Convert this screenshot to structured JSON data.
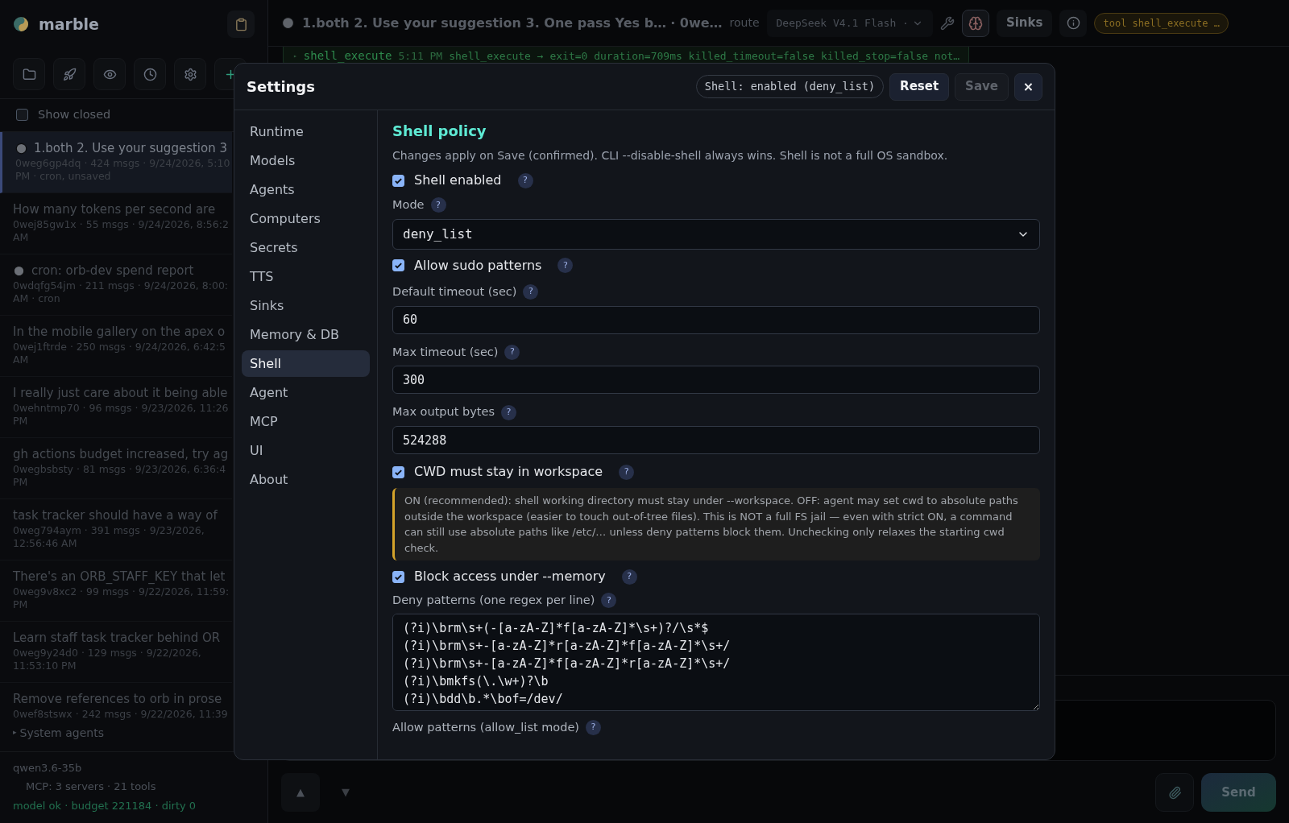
{
  "sidebar": {
    "app_name": "marble",
    "show_closed": {
      "label": "Show closed",
      "checked": false
    },
    "sessions": [
      {
        "title": "1.both 2. Use your suggestion 3",
        "meta": [
          "0weg6gp4dq · 424 msgs · 9/24/2026, 5:10",
          "PM · cron, unsaved"
        ],
        "cron": true,
        "selected": true
      },
      {
        "title": "How many tokens per second are",
        "meta": [
          "0wej85gw1x · 55 msgs · 9/24/2026, 8:56:2",
          "AM"
        ],
        "cron": false,
        "selected": false
      },
      {
        "title": "cron: orb-dev spend report",
        "meta": [
          "0wdqfg54jm · 211 msgs · 9/24/2026, 8:00:",
          "AM · cron"
        ],
        "cron": true,
        "selected": false
      },
      {
        "title": "In the mobile gallery on the apex o",
        "meta": [
          "0wej1ftrde · 250 msgs · 9/24/2026, 6:42:5",
          "AM"
        ],
        "cron": false,
        "selected": false
      },
      {
        "title": "I really just care about it being able",
        "meta": [
          "0wehntmp70 · 96 msgs · 9/23/2026, 11:26",
          "PM"
        ],
        "cron": false,
        "selected": false
      },
      {
        "title": "gh actions budget increased, try ag",
        "meta": [
          "0wegbsbsty · 81 msgs · 9/23/2026, 6:36:4",
          "PM"
        ],
        "cron": false,
        "selected": false
      },
      {
        "title": "task tracker should have a way of",
        "meta": [
          "0weg794aym · 391 msgs · 9/23/2026,",
          "12:56:46 AM"
        ],
        "cron": false,
        "selected": false
      },
      {
        "title": "There's an ORB_STAFF_KEY that let",
        "meta": [
          "0weg9v8xc2 · 99 msgs · 9/22/2026, 11:59:",
          "PM"
        ],
        "cron": false,
        "selected": false
      },
      {
        "title": "Learn staff task tracker behind OR",
        "meta": [
          "0weg9y24d0 · 129 msgs · 9/22/2026,",
          "11:53:10 PM"
        ],
        "cron": false,
        "selected": false
      },
      {
        "title": "Remove references to orb in prose",
        "meta": [
          "0wef8stswx · 242 msgs · 9/22/2026, 11:39"
        ],
        "cron": false,
        "selected": false
      }
    ],
    "system_agents": {
      "arrow": "▸",
      "label": "System agents"
    },
    "footer": {
      "model": "qwen3.6-35b",
      "mcp": "MCP: 3 servers · 21 tools",
      "status": "model ok · budget 221184 · dirty 0"
    }
  },
  "header": {
    "title": "1.both 2. Use your suggestion 3. One pass Yes b…",
    "session": "· 0we…",
    "route_label": "route",
    "model": "DeepSeek V4.1 Flash ·",
    "sinks": "Sinks",
    "tool_badge": "tool shell_execute …"
  },
  "log_line": {
    "arrow": "▸",
    "tool": "shell_execute",
    "time": "5:11 PM",
    "text": "shell_execute → exit=0 duration=709ms killed_timeout=false killed_stop=false not…"
  },
  "settings": {
    "title": "Settings",
    "status_badge": "Shell: enabled (deny_list)",
    "reset": "Reset",
    "save": {
      "label": "Save",
      "disabled": true
    },
    "close": "×",
    "nav": [
      {
        "label": "Runtime",
        "selected": false
      },
      {
        "label": "Models",
        "selected": false
      },
      {
        "label": "Agents",
        "selected": false
      },
      {
        "label": "Computers",
        "selected": false
      },
      {
        "label": "Secrets",
        "selected": false
      },
      {
        "label": "TTS",
        "selected": false
      },
      {
        "label": "Sinks",
        "selected": false
      },
      {
        "label": "Memory & DB",
        "selected": false
      },
      {
        "label": "Shell",
        "selected": true
      },
      {
        "label": "Agent",
        "selected": false
      },
      {
        "label": "MCP",
        "selected": false
      },
      {
        "label": "UI",
        "selected": false
      },
      {
        "label": "About",
        "selected": false
      }
    ],
    "section_title": "Shell policy",
    "description": "Changes apply on Save (confirmed). CLI --disable-shell always wins. Shell is not a full OS sandbox.",
    "items": [
      {
        "kind": "checkbox",
        "label": "Shell enabled",
        "checked": true,
        "help": "?"
      },
      {
        "kind": "select",
        "label": "Mode",
        "value": "deny_list",
        "help": "?"
      },
      {
        "kind": "checkbox",
        "label": "Allow sudo patterns",
        "checked": true,
        "help": "?"
      },
      {
        "kind": "input",
        "label": "Default timeout (sec)",
        "value": "60",
        "help": "?"
      },
      {
        "kind": "input",
        "label": "Max timeout (sec)",
        "value": "300",
        "help": "?"
      },
      {
        "kind": "input",
        "label": "Max output bytes",
        "value": "524288",
        "help": "?"
      },
      {
        "kind": "checkbox",
        "label": "CWD must stay in workspace",
        "checked": true,
        "help": "?"
      },
      {
        "kind": "note",
        "text": "ON (recommended): shell working directory must stay under --workspace. OFF: agent may set cwd to absolute paths outside the workspace (easier to touch out-of-tree files). This is NOT a full FS jail — even with strict ON, a command can still use absolute paths like /etc/… unless deny patterns block them. Unchecking only relaxes the starting cwd check."
      },
      {
        "kind": "checkbox",
        "label": "Block access under --memory",
        "checked": true,
        "help": "?"
      },
      {
        "kind": "textarea",
        "label": "Deny patterns (one regex per line)",
        "help": "?",
        "lines": [
          "(?i)\\brm\\s+(-[a-zA-Z]*f[a-zA-Z]*\\s+)?/\\s*$",
          "(?i)\\brm\\s+-[a-zA-Z]*r[a-zA-Z]*f[a-zA-Z]*\\s+/",
          "(?i)\\brm\\s+-[a-zA-Z]*f[a-zA-Z]*r[a-zA-Z]*\\s+/",
          "(?i)\\bmkfs(\\.\\w+)?\\b",
          "(?i)\\bdd\\b.*\\bof=/dev/"
        ]
      },
      {
        "kind": "label",
        "label": "Allow patterns (allow_list mode)",
        "help": "?"
      }
    ]
  },
  "composer": {
    "up": "▲",
    "down": "▼",
    "send": "Send"
  }
}
